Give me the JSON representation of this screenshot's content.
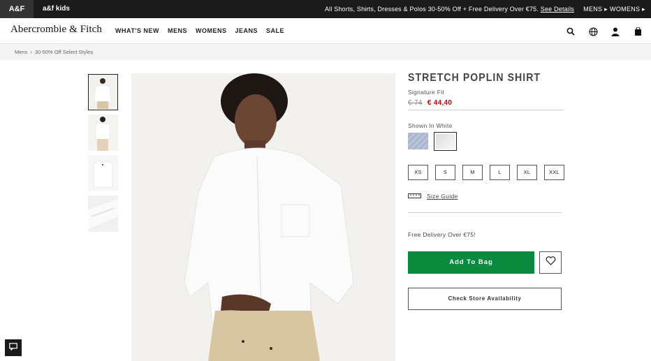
{
  "topbar": {
    "brand_af": "A&F",
    "brand_kids": "a&f kids",
    "promo_text": "All Shorts, Shirts, Dresses & Polos 30-50% Off + Free Delivery Over €75.",
    "promo_link": "See Details",
    "mens": "MENS",
    "womens": "WOMENS"
  },
  "header": {
    "logo": "Abercrombie & Fitch",
    "nav": [
      "WHAT'S NEW",
      "MENS",
      "WOMENS",
      "JEANS",
      "SALE"
    ],
    "icons": [
      "search-icon",
      "globe-icon",
      "account-icon",
      "bag-icon"
    ]
  },
  "breadcrumb": [
    "Mens",
    "30-50% Off Select Styles"
  ],
  "product": {
    "title": "STRETCH POPLIN SHIRT",
    "fit": "Signature Fit",
    "old_price": "€ 74",
    "new_price": "€ 44,40",
    "shown_in": "Shown In White",
    "sizes": [
      "XS",
      "S",
      "M",
      "L",
      "XL",
      "XXL"
    ],
    "size_guide": "Size Guide",
    "delivery": "Free Delivery Over €75!",
    "add_to_bag": "Add To Bag",
    "store_availability": "Check Store Availability"
  },
  "colors": {
    "add_to_bag": "#0a8a3c",
    "sale_price": "#cc0000",
    "topbar": "#1a1a1a"
  }
}
